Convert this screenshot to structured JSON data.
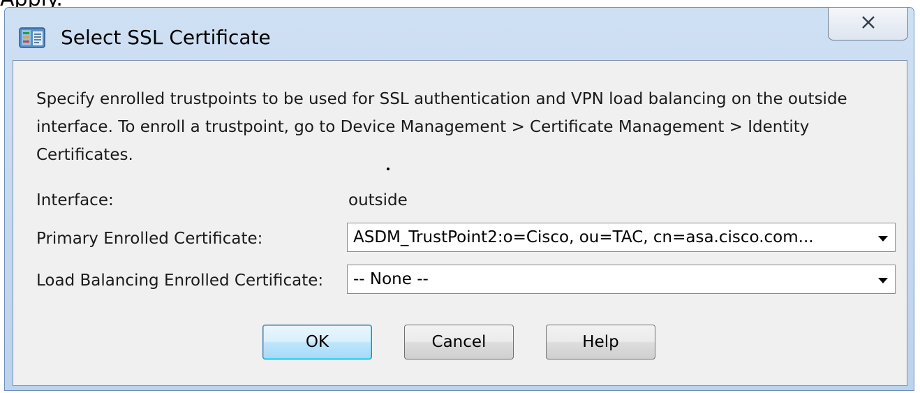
{
  "top_cut_text": "Apply.",
  "window": {
    "title": "Select SSL Certificate",
    "icon": "ssl-certificate-app-icon",
    "close_icon": "close-icon"
  },
  "dialog": {
    "description": "Specify enrolled trustpoints to be used for SSL authentication and VPN load balancing on the outside interface. To enroll a trustpoint, go to Device Management > Certificate Management > Identity Certificates.",
    "interface_label": "Interface:",
    "interface_value": "outside",
    "primary_label": "Primary Enrolled Certificate:",
    "primary_value": "ASDM_TrustPoint2:o=Cisco, ou=TAC, cn=asa.cisco.com...",
    "load_balancing_label": "Load Balancing Enrolled Certificate:",
    "load_balancing_value": "-- None --"
  },
  "buttons": {
    "ok": "OK",
    "cancel": "Cancel",
    "help": "Help"
  },
  "colors": {
    "title_bar": "#c4d8ef",
    "client_background": "#f0f0f0",
    "default_button_border": "#3c7fb1"
  }
}
